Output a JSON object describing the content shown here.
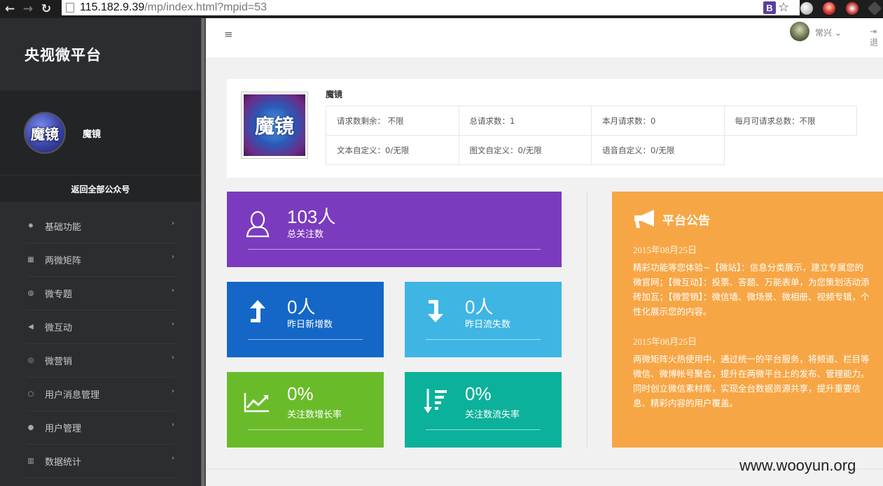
{
  "browser": {
    "url_host": "115.182.9.39",
    "url_path": "/mp/index.html?mpid=53",
    "ext_letter": "B"
  },
  "sidebar": {
    "brand": "央视微平台",
    "profile_name": "魔镜",
    "avatar_text": "魔镜",
    "back_link": "返回全部公众号",
    "items": [
      {
        "label": "基础功能",
        "icon": "gear-icon",
        "glyph": "✹"
      },
      {
        "label": "两微矩阵",
        "icon": "grid-icon",
        "glyph": "▦"
      },
      {
        "label": "微专题",
        "icon": "globe-icon",
        "glyph": "◍"
      },
      {
        "label": "微互动",
        "icon": "megaphone-icon",
        "glyph": "◀"
      },
      {
        "label": "微营销",
        "icon": "target-icon",
        "glyph": "◎"
      },
      {
        "label": "用户消息管理",
        "icon": "comment-icon",
        "glyph": "○"
      },
      {
        "label": "用户管理",
        "icon": "user-icon",
        "glyph": "●"
      },
      {
        "label": "数据统计",
        "icon": "bar-chart-icon",
        "glyph": "▥"
      }
    ]
  },
  "topbar": {
    "user_name": "常兴",
    "logout_label": "退"
  },
  "account": {
    "name": "魔镜",
    "logo_text": "魔镜",
    "stats": {
      "remaining": "请求数剩余： 不限",
      "total": "总请求数：1",
      "this_month": "本月请求数：0",
      "monthly_quota": "每月可请求总数：不限",
      "text_custom": "文本自定义：0/无限",
      "news_custom": "图文自定义：0/无限",
      "voice_custom": "语音自定义：0/无限"
    }
  },
  "tiles": {
    "followers": {
      "value": "103人",
      "label": "总关注数",
      "color": "#7b3bbe"
    },
    "new_yesterday": {
      "value": "0人",
      "label": "昨日新增数",
      "color": "#1467c6"
    },
    "lost_yesterday": {
      "value": "0人",
      "label": "昨日流失数",
      "color": "#3fb5e4"
    },
    "growth_rate": {
      "value": "0%",
      "label": "关注数增长率",
      "color": "#6abb2a"
    },
    "loss_rate": {
      "value": "0%",
      "label": "关注数流失率",
      "color": "#0bb19a"
    }
  },
  "notice": {
    "title": "平台公告",
    "color": "#f7a645",
    "entries": [
      {
        "date": "2015年08月25日",
        "text": "精彩功能等您体验~【微站】：信息分类展示，建立专属您的微官网；【微互动】：投票、答题、万能表单，为您策划活动添砖加瓦；【微营销】：微信墙、微场景、微相册、视频专辑，个性化展示您的内容。"
      },
      {
        "date": "2015年08月25日",
        "text": "两微矩阵火热使用中，通过统一的平台服务，将频道、栏目等微信、微博帐号聚合，提升在两微平台上的发布、管理能力。同时创立微信素材库，实现全台数据资源共享，提升重要信息、精彩内容的用户覆盖。"
      }
    ]
  },
  "watermark": "www.wooyun.org"
}
